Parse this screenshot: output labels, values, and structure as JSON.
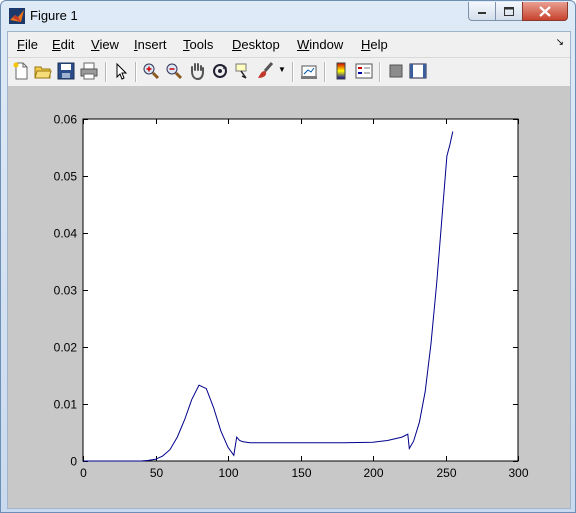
{
  "window": {
    "title": "Figure 1"
  },
  "menubar": {
    "items": [
      {
        "pre": "",
        "ul": "F",
        "post": "ile"
      },
      {
        "pre": "",
        "ul": "E",
        "post": "dit"
      },
      {
        "pre": "",
        "ul": "V",
        "post": "iew"
      },
      {
        "pre": "",
        "ul": "I",
        "post": "nsert"
      },
      {
        "pre": "",
        "ul": "T",
        "post": "ools"
      },
      {
        "pre": "",
        "ul": "D",
        "post": "esktop"
      },
      {
        "pre": "",
        "ul": "W",
        "post": "indow"
      },
      {
        "pre": "",
        "ul": "H",
        "post": "elp"
      }
    ]
  },
  "toolbar": {
    "icons": [
      "new-figure-icon",
      "open-file-icon",
      "save-icon",
      "print-icon",
      "edit-plot-arrow-icon",
      "zoom-in-icon",
      "zoom-out-icon",
      "pan-hand-icon",
      "rotate-3d-icon",
      "data-cursor-icon",
      "brush-icon",
      "brush-dropdown-icon",
      "link-plot-icon",
      "colorbar-icon",
      "legend-icon",
      "hide-plot-tools-icon",
      "show-plot-tools-icon"
    ]
  },
  "colors": {
    "line": "#00008b",
    "figure_bg": "#c8c8c8",
    "axes_bg": "#ffffff"
  },
  "chart_data": {
    "type": "line",
    "xlim": [
      0,
      300
    ],
    "ylim": [
      0,
      0.06
    ],
    "xticks": [
      "0",
      "50",
      "100",
      "150",
      "200",
      "250",
      "300"
    ],
    "yticks": [
      "0",
      "0.01",
      "0.02",
      "0.03",
      "0.04",
      "0.05",
      "0.06"
    ],
    "grid": false,
    "series": [
      {
        "color": "#00008b",
        "x": [
          0,
          40,
          45,
          50,
          55,
          60,
          65,
          70,
          75,
          80,
          85,
          90,
          95,
          100,
          104,
          106,
          108,
          110,
          115,
          120,
          140,
          160,
          180,
          200,
          210,
          220,
          224,
          225,
          228,
          232,
          236,
          240,
          244,
          248,
          251,
          253,
          255
        ],
        "y": [
          0,
          0,
          0.0001,
          0.0003,
          0.0009,
          0.002,
          0.0042,
          0.0072,
          0.0108,
          0.0133,
          0.0127,
          0.0094,
          0.0053,
          0.0024,
          0.001,
          0.0042,
          0.0036,
          0.0034,
          0.0032,
          0.0032,
          0.0032,
          0.0032,
          0.0032,
          0.0033,
          0.0036,
          0.0042,
          0.0047,
          0.0022,
          0.0035,
          0.0068,
          0.0122,
          0.0206,
          0.0314,
          0.0441,
          0.0535,
          0.0555,
          0.0578
        ]
      }
    ]
  }
}
